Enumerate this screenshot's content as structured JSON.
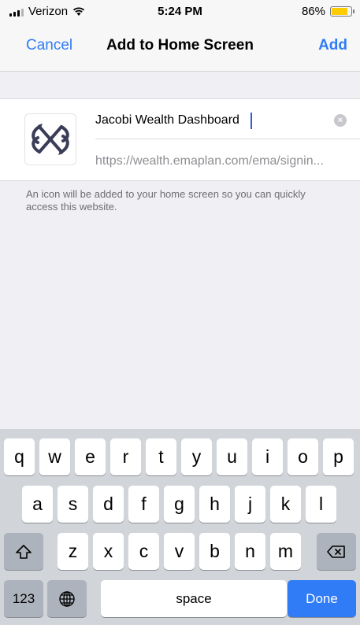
{
  "status_bar": {
    "carrier": "Verizon",
    "time": "5:24 PM",
    "battery": "86%",
    "battery_level": 0.86,
    "battery_color": "#ffcc00"
  },
  "nav": {
    "cancel_label": "Cancel",
    "title": "Add to Home Screen",
    "add_label": "Add",
    "accent": "#2f7cf6"
  },
  "form": {
    "name_value": "Jacobi Wealth Dashboard",
    "url": "https://wealth.emaplan.com/ema/signin...",
    "clear_icon": "clear-circle-icon"
  },
  "note": "An icon will be added to your home screen so you can quickly access this website.",
  "keyboard": {
    "row1": [
      "q",
      "w",
      "e",
      "r",
      "t",
      "y",
      "u",
      "i",
      "o",
      "p"
    ],
    "row2": [
      "a",
      "s",
      "d",
      "f",
      "g",
      "h",
      "j",
      "k",
      "l"
    ],
    "row3": [
      "z",
      "x",
      "c",
      "v",
      "b",
      "n",
      "m"
    ],
    "numbers_label": "123",
    "space_label": "space",
    "done_label": "Done",
    "shift_icon": "shift-icon",
    "delete_icon": "delete-icon",
    "globe_icon": "globe-icon"
  }
}
